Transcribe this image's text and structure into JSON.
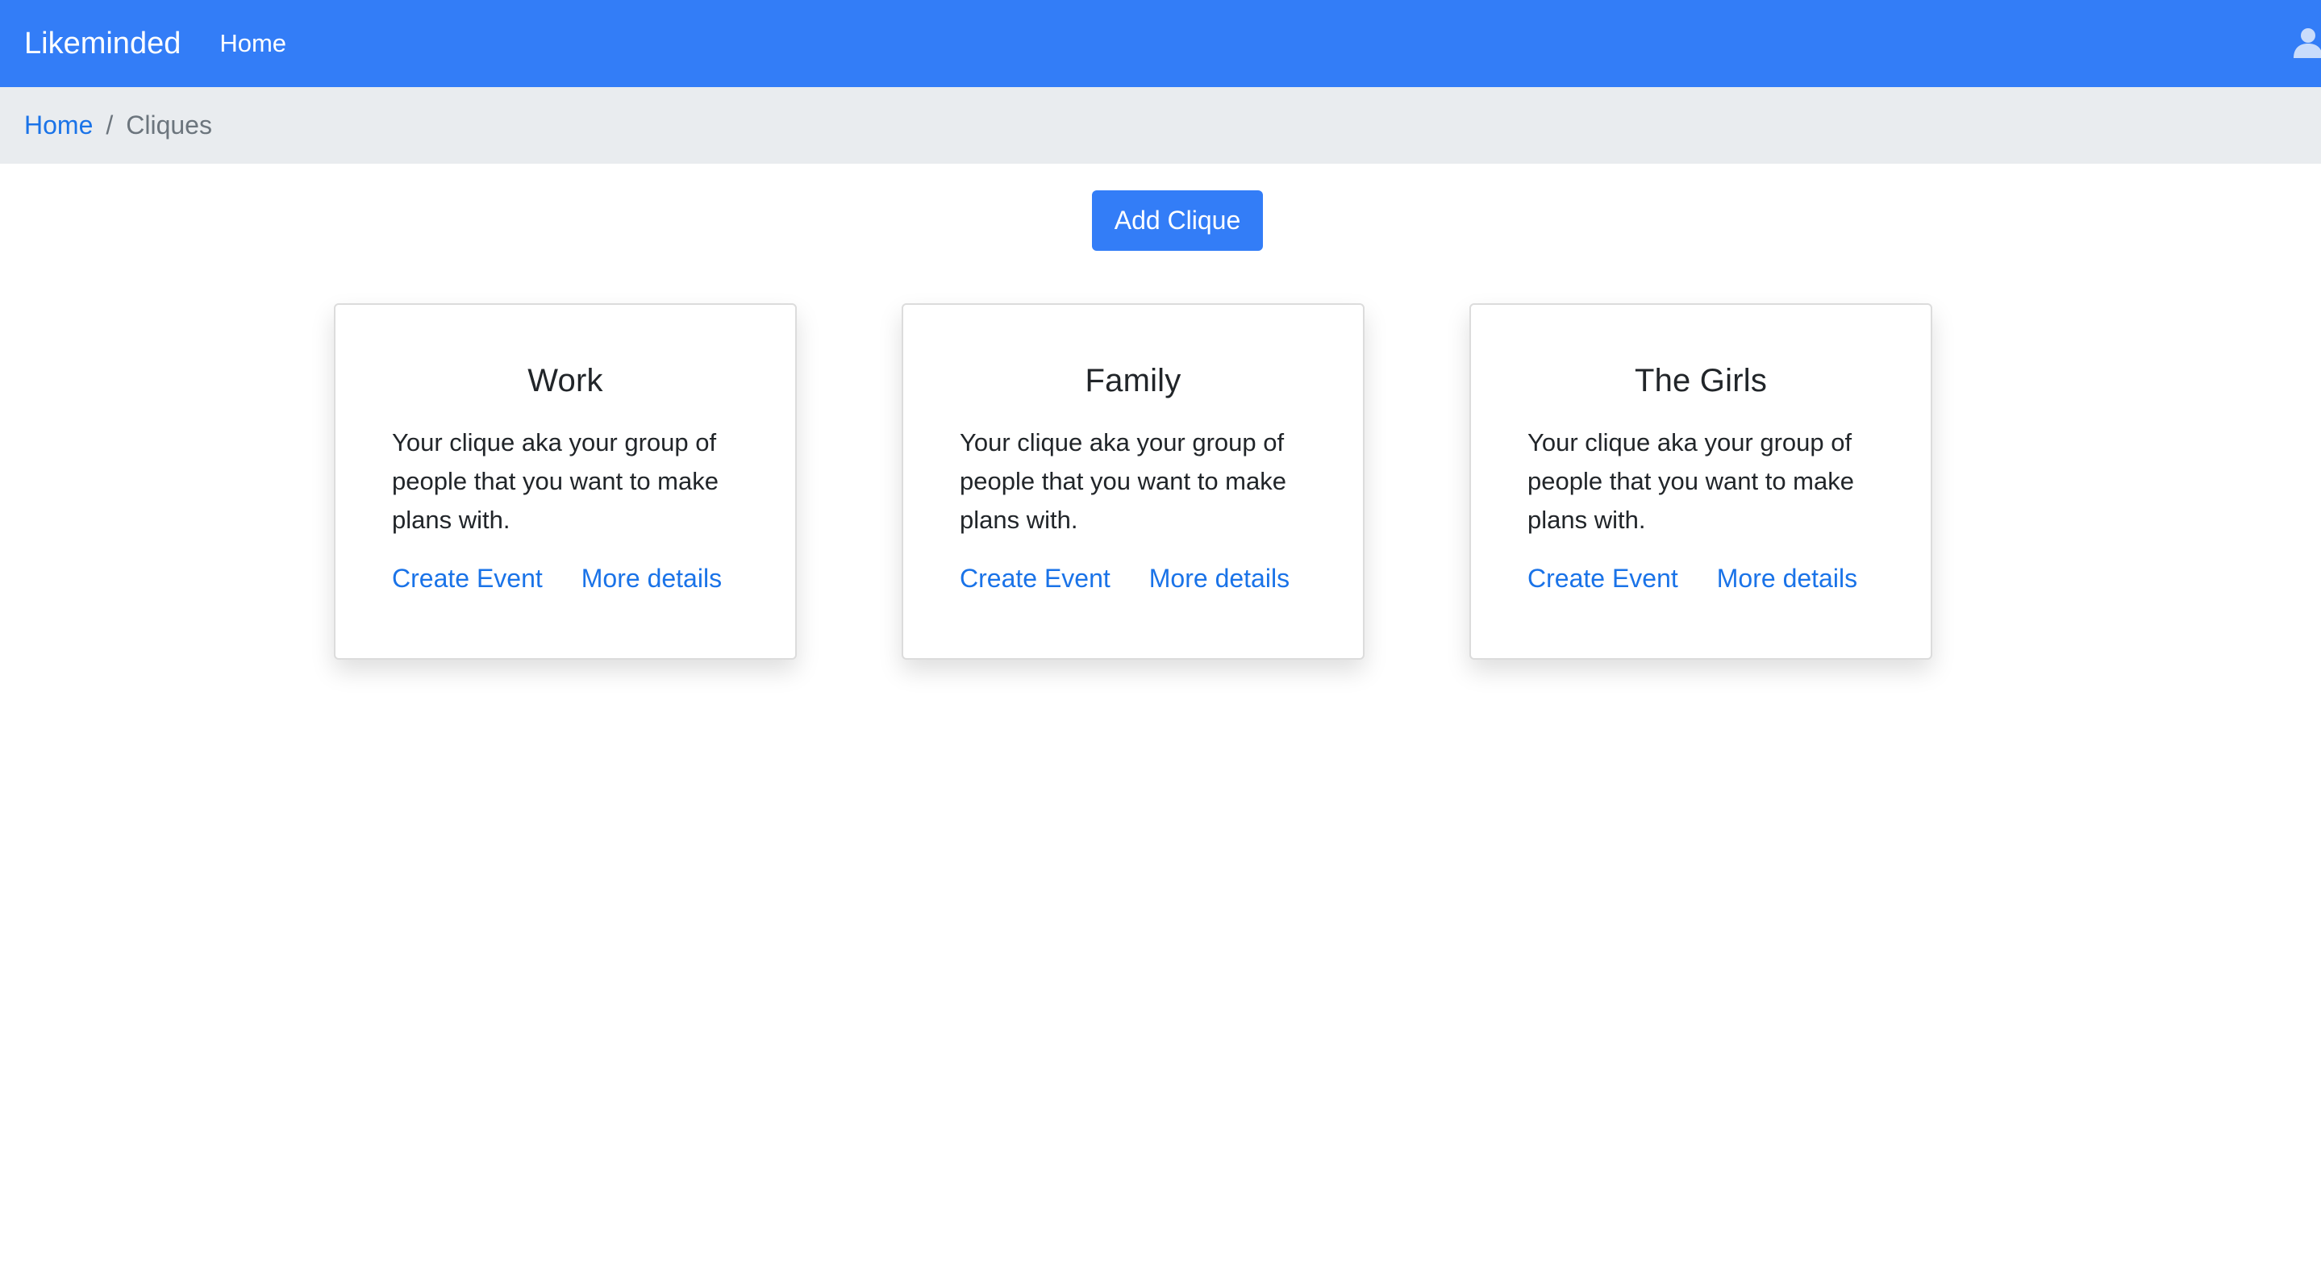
{
  "navbar": {
    "brand": "Likeminded",
    "links": [
      {
        "label": "Home"
      }
    ],
    "user_icon": "user-icon"
  },
  "breadcrumb": {
    "items": [
      {
        "label": "Home",
        "link": true
      },
      {
        "label": "Cliques",
        "link": false
      }
    ],
    "separator": "/"
  },
  "main": {
    "add_button_label": "Add Clique",
    "cards": [
      {
        "title": "Work",
        "text": "Your clique aka your group of people that you want to make plans with.",
        "links": [
          "Create Event",
          "More details"
        ]
      },
      {
        "title": "Family",
        "text": "Your clique aka your group of people that you want to make plans with.",
        "links": [
          "Create Event",
          "More details"
        ]
      },
      {
        "title": "The Girls",
        "text": "Your clique aka your group of people that you want to make plans with.",
        "links": [
          "Create Event",
          "More details"
        ]
      }
    ]
  },
  "colors": {
    "primary": "#337df7",
    "link": "#1a73e8",
    "breadcrumb_bg": "#e9ecef",
    "muted": "#6c757d"
  }
}
